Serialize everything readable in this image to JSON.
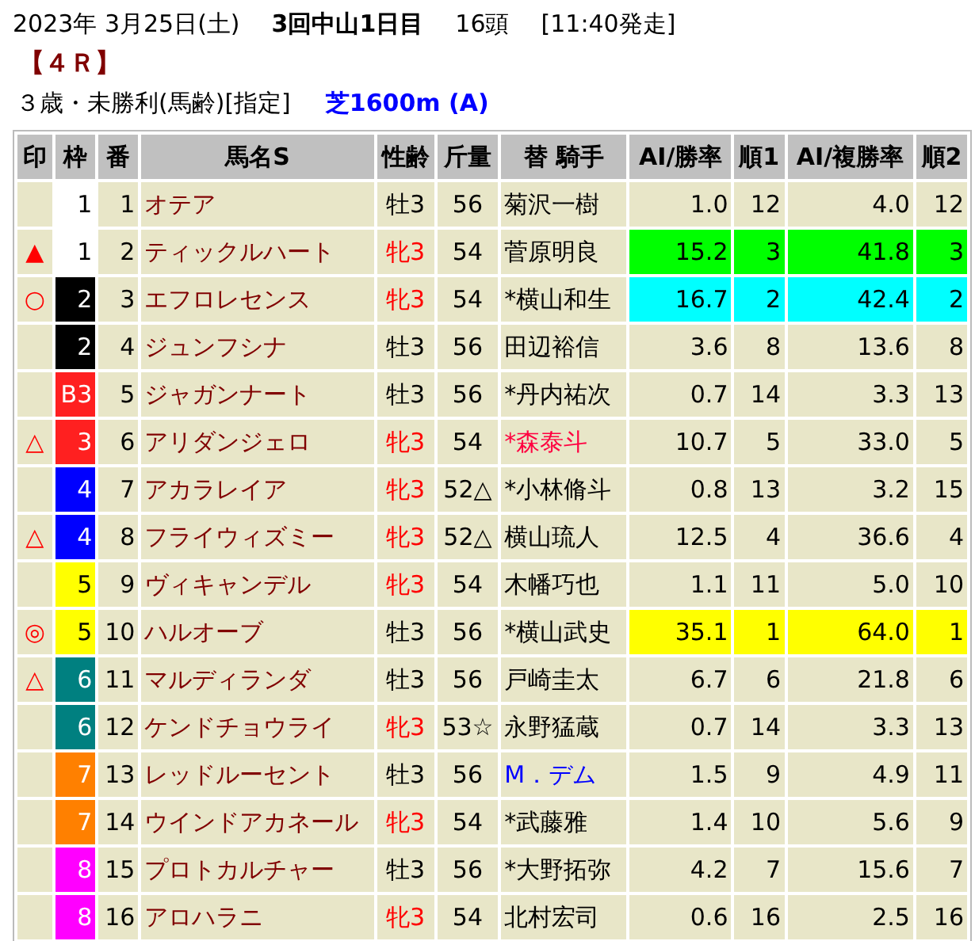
{
  "header": {
    "date": "2023年 3月25日(土)",
    "meeting": "3回中山1日目",
    "runners": "16頭",
    "start": "[11:40発走]"
  },
  "race": {
    "number": "【４Ｒ】",
    "condition": "３歳・未勝利(馬齢)[指定]",
    "course": "芝1600m (A)"
  },
  "table": {
    "columns": [
      "印",
      "枠",
      "番",
      "馬名S",
      "性齢",
      "斤量",
      "替 騎手",
      "AI/勝率",
      "順1",
      "AI/複勝率",
      "順2"
    ],
    "rows": [
      {
        "frame": {
          "label": "1",
          "color": "#ffffff"
        },
        "number": "1",
        "horse": "オテア",
        "sex_age": "牡3",
        "sex_red": false,
        "weight": "56",
        "jockey": {
          "name": "菊沢一樹"
        },
        "win": "1.0",
        "rank1": "12",
        "place": "4.0",
        "rank2": "12"
      },
      {
        "mark": "▲",
        "frame": {
          "label": "1",
          "color": "#ffffff"
        },
        "number": "2",
        "horse": "ティックルハート",
        "sex_age": "牝3",
        "sex_red": true,
        "weight": "54",
        "jockey": {
          "name": "菅原明良"
        },
        "win": "15.2",
        "rank1": "3",
        "place": "41.8",
        "rank2": "3",
        "highlight": {
          "color": "#00ff00"
        }
      },
      {
        "mark": "○",
        "frame": {
          "label": "2",
          "color": "#000000"
        },
        "number": "3",
        "horse": "エフロレセンス",
        "sex_age": "牝3",
        "sex_red": true,
        "weight": "54",
        "jockey": {
          "name": "*横山和生"
        },
        "win": "16.7",
        "rank1": "2",
        "place": "42.4",
        "rank2": "2",
        "highlight": {
          "color": "#00ffff"
        }
      },
      {
        "frame": {
          "label": "2",
          "color": "#000000"
        },
        "number": "4",
        "horse": "ジュンフシナ",
        "sex_age": "牡3",
        "sex_red": false,
        "weight": "56",
        "jockey": {
          "name": "田辺裕信"
        },
        "win": "3.6",
        "rank1": "8",
        "place": "13.6",
        "rank2": "8"
      },
      {
        "frame": {
          "label": "B3",
          "color": "#ff2020"
        },
        "number": "5",
        "horse": "ジャガンナート",
        "sex_age": "牡3",
        "sex_red": false,
        "weight": "56",
        "jockey": {
          "name": "*丹内祐次"
        },
        "win": "0.7",
        "rank1": "14",
        "place": "3.3",
        "rank2": "13"
      },
      {
        "mark": "△",
        "frame": {
          "label": "3",
          "color": "#ff2020"
        },
        "number": "6",
        "horse": "アリダンジェロ",
        "sex_age": "牝3",
        "sex_red": true,
        "weight": "54",
        "jockey": {
          "name": "*森泰斗",
          "color": "#ff0040"
        },
        "win": "10.7",
        "rank1": "5",
        "place": "33.0",
        "rank2": "5"
      },
      {
        "frame": {
          "label": "4",
          "color": "#0000ff"
        },
        "number": "7",
        "horse": "アカラレイア",
        "sex_age": "牝3",
        "sex_red": true,
        "weight": "52△",
        "jockey": {
          "name": "*小林脩斗"
        },
        "win": "0.8",
        "rank1": "13",
        "place": "3.2",
        "rank2": "15"
      },
      {
        "mark": "△",
        "frame": {
          "label": "4",
          "color": "#0000ff"
        },
        "number": "8",
        "horse": "フライウィズミー",
        "sex_age": "牝3",
        "sex_red": true,
        "weight": "52△",
        "jockey": {
          "name": "横山琉人"
        },
        "win": "12.5",
        "rank1": "4",
        "place": "36.6",
        "rank2": "4"
      },
      {
        "frame": {
          "label": "5",
          "color": "#ffff00"
        },
        "number": "9",
        "horse": "ヴィキャンデル",
        "sex_age": "牝3",
        "sex_red": true,
        "weight": "54",
        "jockey": {
          "name": "木幡巧也"
        },
        "win": "1.1",
        "rank1": "11",
        "place": "5.0",
        "rank2": "10"
      },
      {
        "mark": "◎",
        "frame": {
          "label": "5",
          "color": "#ffff00"
        },
        "number": "10",
        "horse": "ハルオーブ",
        "sex_age": "牡3",
        "sex_red": false,
        "weight": "56",
        "jockey": {
          "name": "*横山武史"
        },
        "win": "35.1",
        "rank1": "1",
        "place": "64.0",
        "rank2": "1",
        "highlight": {
          "color": "#ffff00"
        }
      },
      {
        "mark": "△",
        "frame": {
          "label": "6",
          "color": "#008080"
        },
        "number": "11",
        "horse": "マルディランダ",
        "sex_age": "牡3",
        "sex_red": false,
        "weight": "56",
        "jockey": {
          "name": "戸崎圭太"
        },
        "win": "6.7",
        "rank1": "6",
        "place": "21.8",
        "rank2": "6"
      },
      {
        "frame": {
          "label": "6",
          "color": "#008080"
        },
        "number": "12",
        "horse": "ケンドチョウライ",
        "sex_age": "牝3",
        "sex_red": true,
        "weight": "53☆",
        "jockey": {
          "name": "永野猛蔵"
        },
        "win": "0.7",
        "rank1": "14",
        "place": "3.3",
        "rank2": "13"
      },
      {
        "frame": {
          "label": "7",
          "color": "#ff8000"
        },
        "number": "13",
        "horse": "レッドルーセント",
        "sex_age": "牡3",
        "sex_red": false,
        "weight": "56",
        "jockey": {
          "name": "M．デム",
          "color": "#0000ff"
        },
        "win": "1.5",
        "rank1": "9",
        "place": "4.9",
        "rank2": "11"
      },
      {
        "frame": {
          "label": "7",
          "color": "#ff8000"
        },
        "number": "14",
        "horse": "ウインドアカネール",
        "sex_age": "牝3",
        "sex_red": true,
        "weight": "54",
        "jockey": {
          "name": "*武藤雅"
        },
        "win": "1.4",
        "rank1": "10",
        "place": "5.6",
        "rank2": "9"
      },
      {
        "frame": {
          "label": "8",
          "color": "#ff00ff"
        },
        "number": "15",
        "horse": "プロトカルチャー",
        "sex_age": "牡3",
        "sex_red": false,
        "weight": "56",
        "jockey": {
          "name": "*大野拓弥"
        },
        "win": "4.2",
        "rank1": "7",
        "place": "15.6",
        "rank2": "7"
      },
      {
        "frame": {
          "label": "8",
          "color": "#ff00ff"
        },
        "number": "16",
        "horse": "アロハラニ",
        "sex_age": "牝3",
        "sex_red": true,
        "weight": "54",
        "jockey": {
          "name": "北村宏司"
        },
        "win": "0.6",
        "rank1": "16",
        "place": "2.5",
        "rank2": "16"
      }
    ]
  }
}
